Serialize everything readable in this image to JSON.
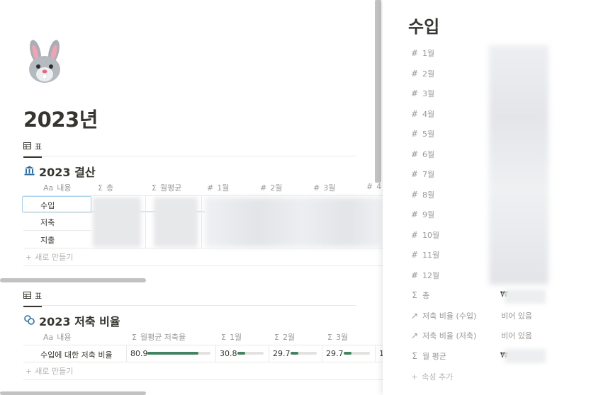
{
  "page": {
    "title": "2023년",
    "icon": "rabbit-face-icon"
  },
  "db1": {
    "view_tab": "표",
    "title": "2023 결산",
    "title_icon": "bank-icon",
    "columns": [
      {
        "icon": "Aa",
        "label": "내용"
      },
      {
        "icon": "Σ",
        "label": "총"
      },
      {
        "icon": "Σ",
        "label": "월평균"
      },
      {
        "icon": "#",
        "label": "1월"
      },
      {
        "icon": "#",
        "label": "2월"
      },
      {
        "icon": "#",
        "label": "3월"
      },
      {
        "icon": "#",
        "label": "4"
      }
    ],
    "rows": [
      "수입",
      "저축",
      "지출"
    ],
    "new_row": "새로 만들기"
  },
  "db2": {
    "view_tab": "표",
    "title": "2023 저축 비율",
    "title_icon": "coins-icon",
    "columns": [
      {
        "icon": "Aa",
        "label": "내용"
      },
      {
        "icon": "Σ",
        "label": "월평균 저축율"
      },
      {
        "icon": "Σ",
        "label": "1월"
      },
      {
        "icon": "Σ",
        "label": "2월"
      },
      {
        "icon": "Σ",
        "label": "3월"
      }
    ],
    "row": {
      "label": "수입에 대한 저축 비율",
      "values": [
        "80.9",
        "30.8",
        "29.7",
        "29.7",
        "1"
      ],
      "bar_fraction": [
        0.809,
        0.308,
        0.297,
        0.297
      ]
    },
    "new_row": "새로 만들기"
  },
  "peek": {
    "title": "수입",
    "properties": [
      {
        "icon": "#",
        "label": "1월",
        "value": ""
      },
      {
        "icon": "#",
        "label": "2월",
        "value": ""
      },
      {
        "icon": "#",
        "label": "3월",
        "value": ""
      },
      {
        "icon": "#",
        "label": "4월",
        "value": ""
      },
      {
        "icon": "#",
        "label": "5월",
        "value": ""
      },
      {
        "icon": "#",
        "label": "6월",
        "value": ""
      },
      {
        "icon": "#",
        "label": "7월",
        "value": ""
      },
      {
        "icon": "#",
        "label": "8월",
        "value": ""
      },
      {
        "icon": "#",
        "label": "9월",
        "value": ""
      },
      {
        "icon": "#",
        "label": "10월",
        "value": ""
      },
      {
        "icon": "#",
        "label": "11월",
        "value": ""
      },
      {
        "icon": "#",
        "label": "12월",
        "value": ""
      },
      {
        "icon": "Σ",
        "label": "총",
        "value": "₩"
      },
      {
        "icon": "↗",
        "label": "저축 비율 (수입)",
        "value": "비어 있음"
      },
      {
        "icon": "↗",
        "label": "저축 비율 (저축)",
        "value": "비어 있음"
      },
      {
        "icon": "Σ",
        "label": "월 평균",
        "value": "₩"
      }
    ],
    "add_property": "속성 추가"
  },
  "colors": {
    "text": "#37352f",
    "muted": "#9b9a97",
    "bar": "#448361",
    "selection": "#a6cfe8"
  }
}
